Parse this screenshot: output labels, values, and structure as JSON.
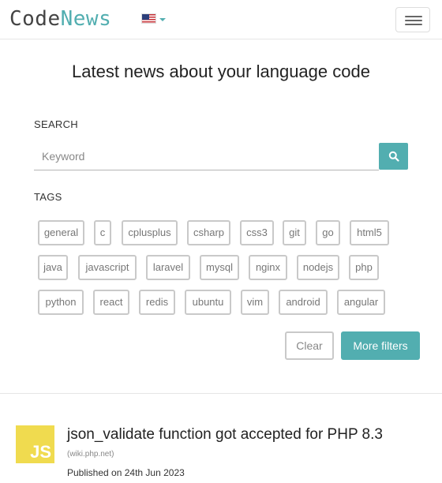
{
  "brand": {
    "code": "Code",
    "news": "News"
  },
  "header": {
    "language_flag_icon": "us-flag-icon",
    "menu_icon": "hamburger-icon"
  },
  "headline": "Latest news about your language code",
  "search": {
    "label": "SEARCH",
    "placeholder": "Keyword",
    "value": "",
    "button_icon": "search-icon"
  },
  "tags": {
    "label": "TAGS",
    "items": [
      "general",
      "c",
      "cplusplus",
      "csharp",
      "css3",
      "git",
      "go",
      "html5",
      "java",
      "javascript",
      "laravel",
      "mysql",
      "nginx",
      "nodejs",
      "php",
      "python",
      "react",
      "redis",
      "ubuntu",
      "vim",
      "android",
      "angular"
    ]
  },
  "actions": {
    "clear_label": "Clear",
    "more_filters_label": "More filters"
  },
  "news": [
    {
      "logo_text": "JS",
      "title": "json_validate function got accepted for PHP 8.3",
      "source": "(wiki.php.net)",
      "date": "Published on 24th Jun 2023"
    }
  ],
  "colors": {
    "accent": "#52aeb0",
    "js_logo": "#f0db4f",
    "tag_border": "#c9c9c9"
  }
}
